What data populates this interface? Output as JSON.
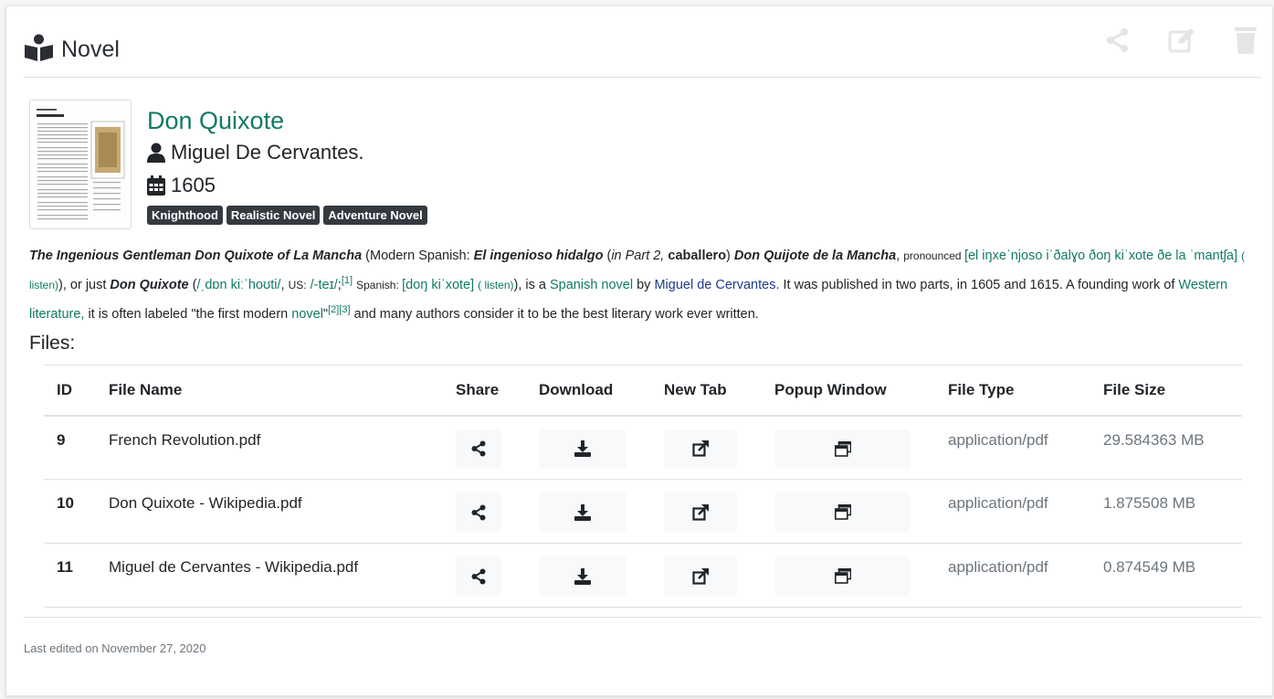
{
  "header": {
    "title": "Novel",
    "icons": [
      "book-reader-icon",
      "share-icon",
      "edit-icon",
      "trash-icon"
    ]
  },
  "book": {
    "title": "Don Quixote",
    "author": "Miguel De Cervantes.",
    "year": "1605",
    "tags": [
      "Knighthood",
      "Realistic Novel",
      "Adventure Novel"
    ]
  },
  "description": {
    "d1": "The Ingenious Gentleman Don Quixote of La Mancha",
    "d2": " (Modern Spanish: ",
    "d3": "El ingenioso hidalgo",
    "d4": " (",
    "d5": "in Part 2,",
    "d6": " ",
    "d7": "caballero",
    "d8": ") ",
    "d9": "Don Quijote de la Mancha",
    "d10": ", ",
    "d11": "pronounced ",
    "d12": "[el iŋxeˈnjoso iˈðalɣo ðoŋ kiˈxote ðe la ˈmantʃa]",
    "d13": " ",
    "d14": "( listen)",
    "d15": "), or just ",
    "d16": "Don Quixote",
    "d17": " (",
    "d18": "/ˌdɒn kiːˈhoʊti/",
    "d19": ", ",
    "d20": "US:",
    "d21": " ",
    "d22": "/-teɪ/",
    "d23": ";",
    "d24": "[1]",
    "d25": " ",
    "d26": "Spanish: ",
    "d27": "[doŋ kiˈxote]",
    "d28": " ",
    "d29": "( listen)",
    "d30": "), is a ",
    "d31": "Spanish novel",
    "d32": " by ",
    "d33": "Miguel de Cervantes.",
    "d34": " It was published in two parts, in 1605 and 1615. A founding work of ",
    "d35": "Western literature,",
    "d36": " it is often labeled \"the first modern ",
    "d37": "novel",
    "d38": "\"",
    "d39": "[2]",
    "d40": "[3]",
    "d41": " and many authors consider it to be the best literary work ever written."
  },
  "files": {
    "heading": "Files:",
    "columns": [
      "ID",
      "File Name",
      "Share",
      "Download",
      "New Tab",
      "Popup Window",
      "File Type",
      "File Size"
    ],
    "rows": [
      {
        "id": "9",
        "name": "French Revolution.pdf",
        "type": "application/pdf",
        "size": "29.584363 MB"
      },
      {
        "id": "10",
        "name": "Don Quixote - Wikipedia.pdf",
        "type": "application/pdf",
        "size": "1.875508 MB"
      },
      {
        "id": "11",
        "name": "Miguel de Cervantes - Wikipedia.pdf",
        "type": "application/pdf",
        "size": "0.874549 MB"
      }
    ],
    "row_icons": [
      "share-icon",
      "download-icon",
      "external-link-icon",
      "window-icon"
    ]
  },
  "footer": {
    "last_edited": "Last edited on November 27, 2020"
  },
  "colors": {
    "accent": "#117a65",
    "tag_bg": "#343a40",
    "muted": "#6c757d"
  }
}
